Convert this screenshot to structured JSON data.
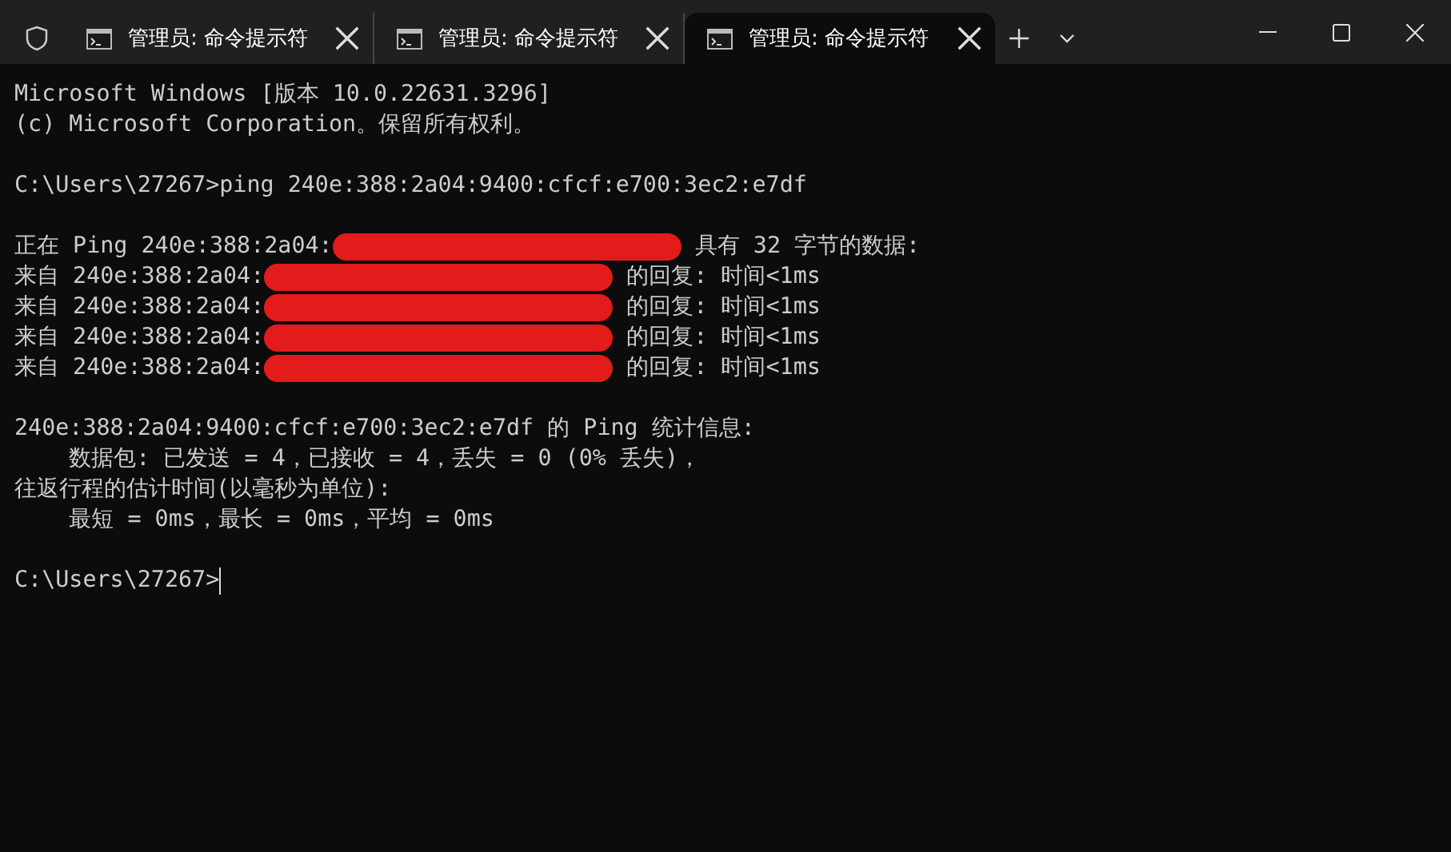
{
  "tabs": [
    {
      "title": "管理员: 命令提示符",
      "selected": false
    },
    {
      "title": "管理员: 命令提示符",
      "selected": false
    },
    {
      "title": "管理员: 命令提示符",
      "selected": true
    }
  ],
  "terminal": {
    "lines": [
      {
        "kind": "text",
        "text": "Microsoft Windows [版本 10.0.22631.3296]"
      },
      {
        "kind": "text",
        "text": "(c) Microsoft Corporation。保留所有权利。"
      },
      {
        "kind": "blank"
      },
      {
        "kind": "text",
        "text": "C:\\Users\\27267>ping 240e:388:2a04:9400:cfcf:e700:3ec2:e7df"
      },
      {
        "kind": "blank"
      },
      {
        "kind": "redacted",
        "before": "正在 Ping 240e:388:2a04:",
        "after": " 具有 32 字节的数据:"
      },
      {
        "kind": "redacted",
        "before": "来自 240e:388:2a04:",
        "after": " 的回复: 时间<1ms"
      },
      {
        "kind": "redacted",
        "before": "来自 240e:388:2a04:",
        "after": " 的回复: 时间<1ms"
      },
      {
        "kind": "redacted",
        "before": "来自 240e:388:2a04:",
        "after": " 的回复: 时间<1ms"
      },
      {
        "kind": "redacted",
        "before": "来自 240e:388:2a04:",
        "after": " 的回复: 时间<1ms"
      },
      {
        "kind": "blank"
      },
      {
        "kind": "text",
        "text": "240e:388:2a04:9400:cfcf:e700:3ec2:e7df 的 Ping 统计信息:"
      },
      {
        "kind": "text",
        "text": "    数据包: 已发送 = 4，已接收 = 4，丢失 = 0 (0% 丢失)，"
      },
      {
        "kind": "text",
        "text": "往返行程的估计时间(以毫秒为单位):"
      },
      {
        "kind": "text",
        "text": "    最短 = 0ms，最长 = 0ms，平均 = 0ms"
      },
      {
        "kind": "blank"
      },
      {
        "kind": "prompt",
        "text": "C:\\Users\\27267>"
      }
    ]
  }
}
